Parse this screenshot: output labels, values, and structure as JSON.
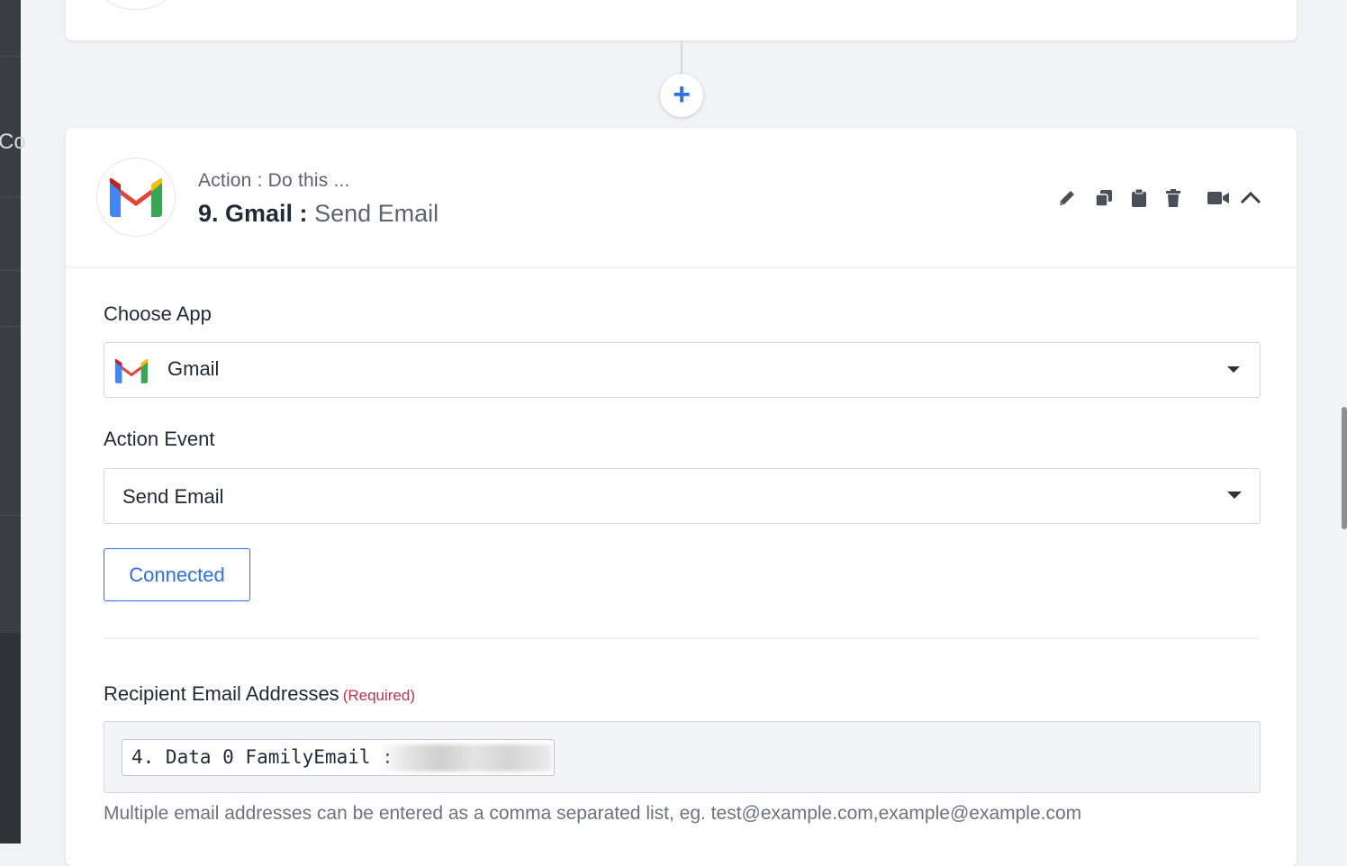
{
  "sidebar": {
    "partial_text": "Co"
  },
  "connector": {
    "add_label": "+"
  },
  "step": {
    "subtitle": "Action : Do this ...",
    "number_app": "9. Gmail :",
    "event": "Send Email",
    "icon": "gmail-icon"
  },
  "toolbar": {
    "icons": [
      "pencil-icon",
      "copy-icon",
      "clipboard-icon",
      "trash-icon",
      "video-icon",
      "chevron-up-icon"
    ]
  },
  "form": {
    "choose_app_label": "Choose App",
    "choose_app_value": "Gmail",
    "action_event_label": "Action Event",
    "action_event_value": "Send Email",
    "connected_label": "Connected",
    "recipient_label": "Recipient Email Addresses",
    "recipient_required": "(Required)",
    "recipient_token": "4. Data 0 FamilyEmail : g",
    "helper_text": "Multiple email addresses can be entered as a comma separated list, eg. test@example.com,example@example.com"
  },
  "colors": {
    "accent": "#2f6fea",
    "required": "#c0334a",
    "sidebar": "#3a3d42"
  }
}
